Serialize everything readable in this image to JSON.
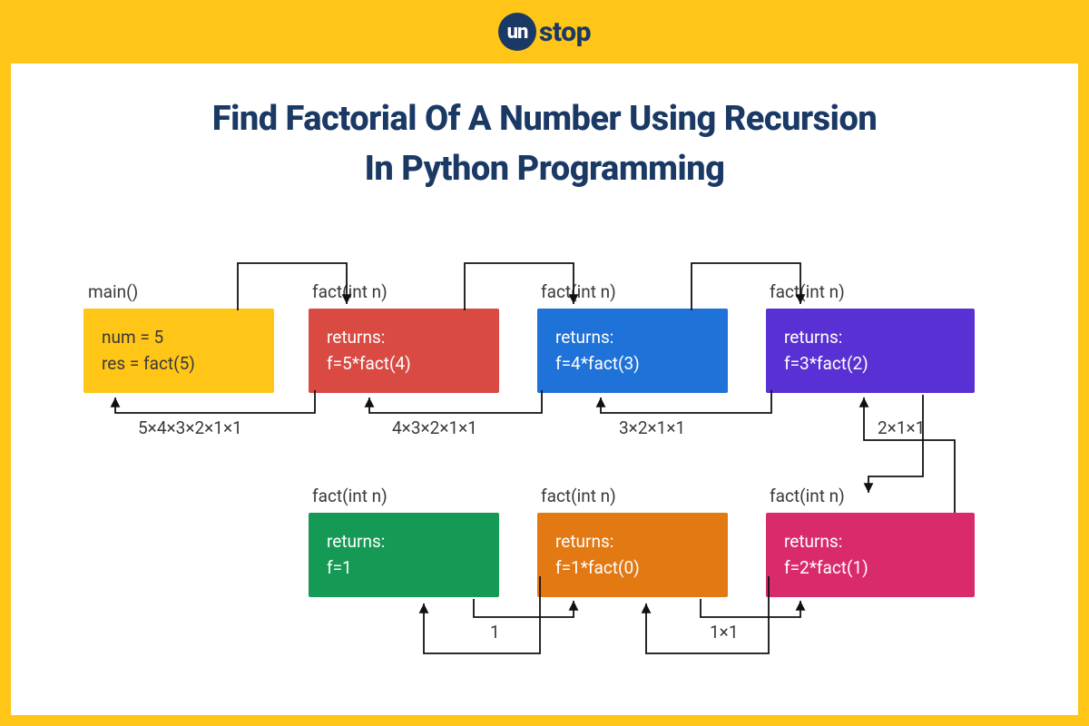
{
  "brand": {
    "badge": "un",
    "text": "stop"
  },
  "title_line1": "Find Factorial Of A Number Using Recursion",
  "title_line2": "In Python Programming",
  "labels": {
    "main": "main()",
    "fn": "fact(int n)",
    "ret_yellow_1": "num = 5",
    "ret_yellow_2": "res = fact(5)",
    "ret_red_1": "returns:",
    "ret_red_2": "f=5*fact(4)",
    "ret_blue_1": "returns:",
    "ret_blue_2": "f=4*fact(3)",
    "ret_purple_1": "returns:",
    "ret_purple_2": "f=3*fact(2)",
    "ret_green_1": "returns:",
    "ret_green_2": "f=1",
    "ret_orange_1": "returns:",
    "ret_orange_2": "f=1*fact(0)",
    "ret_pink_1": "returns:",
    "ret_pink_2": "f=2*fact(1)",
    "val_5": "5×4×3×2×1×1",
    "val_4": "4×3×2×1×1",
    "val_3": "3×2×1×1",
    "val_2": "2×1×1",
    "val_1_1": "1×1",
    "val_1": "1"
  }
}
